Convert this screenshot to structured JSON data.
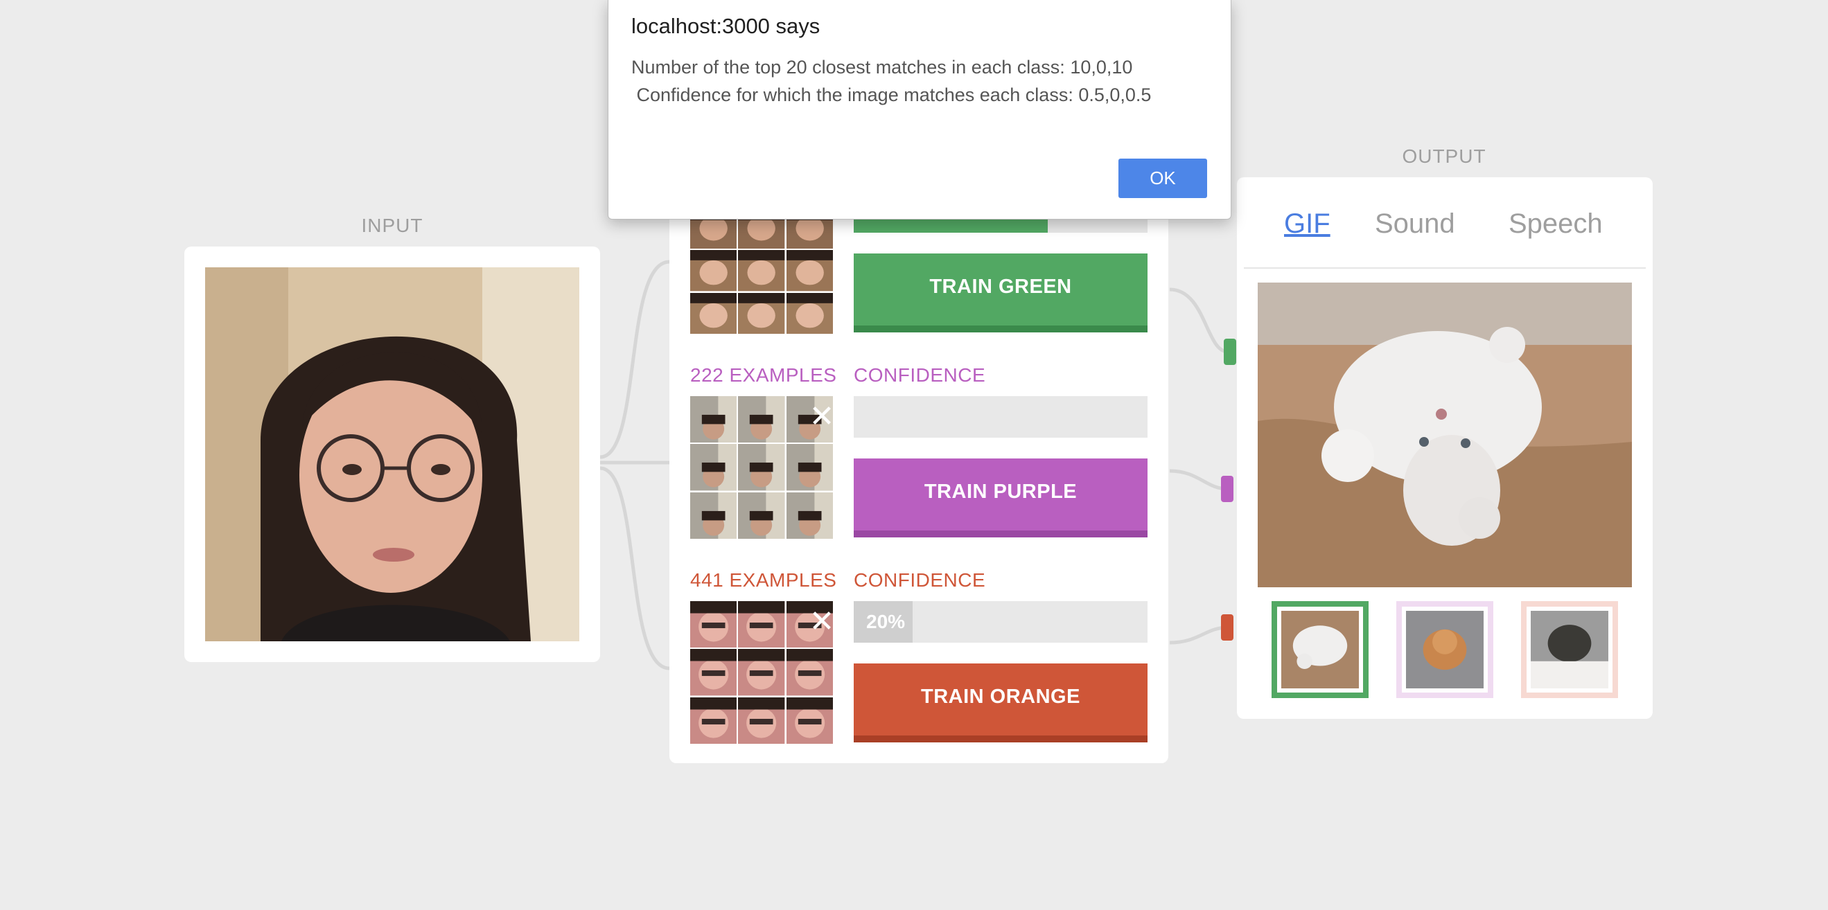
{
  "colors": {
    "background": "#ececec",
    "green": "#52a863",
    "green_dark": "#3a8a4b",
    "purple": "#b95fc0",
    "purple_dark": "#9a47a3",
    "orange": "#cf5638",
    "orange_dark": "#a93f26",
    "label_gray": "#9e9e9e",
    "link_blue": "#4a7de0",
    "ok_blue": "#4d86e8"
  },
  "input": {
    "label": "INPUT"
  },
  "output": {
    "label": "OUTPUT",
    "tabs": [
      {
        "label": "GIF",
        "active": true
      },
      {
        "label": "Sound",
        "active": false
      },
      {
        "label": "Speech",
        "active": false
      }
    ],
    "gif_options": [
      {
        "icon": "white-cat-gif",
        "selected": true
      },
      {
        "icon": "orange-cat-gif",
        "selected": false
      },
      {
        "icon": "black-cat-gif",
        "selected": false
      }
    ]
  },
  "classes": {
    "green": {
      "train_label": "TRAIN GREEN"
    },
    "purple": {
      "examples": "222 EXAMPLES",
      "confidence_label": "CONFIDENCE",
      "train_label": "TRAIN PURPLE"
    },
    "orange": {
      "examples": "441 EXAMPLES",
      "confidence_label": "CONFIDENCE",
      "confidence_text": "20%",
      "confidence_value": 0.2,
      "train_label": "TRAIN ORANGE"
    }
  },
  "dialog": {
    "title": "localhost:3000 says",
    "line1": "Number of the top 20 closest matches in each class: 10,0,10",
    "line2": " Confidence for which the image matches each class: 0.5,0,0.5",
    "ok_label": "OK"
  }
}
